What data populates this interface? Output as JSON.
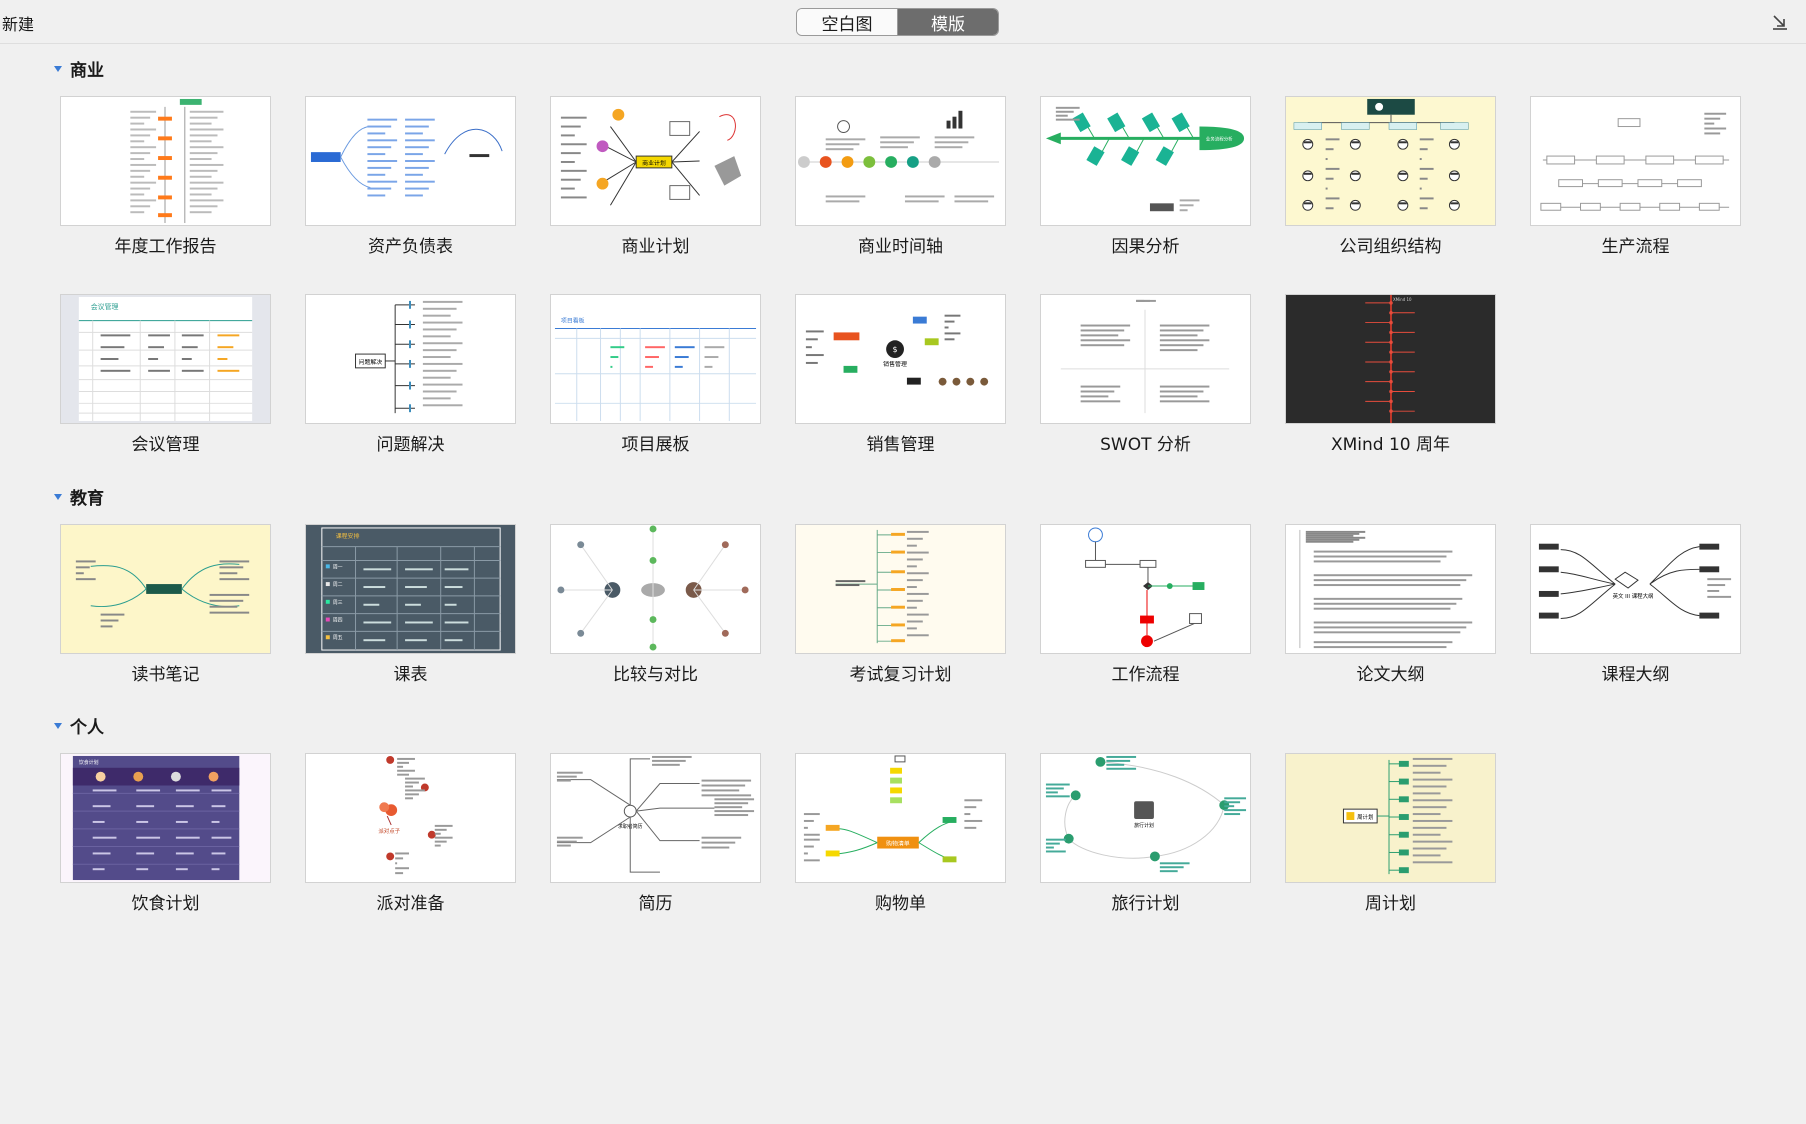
{
  "header": {
    "title": "新建",
    "tab_blank": "空白图",
    "tab_template": "模版",
    "import_icon": "import-arrow-icon"
  },
  "sections": [
    {
      "title": "商业",
      "items": [
        {
          "label": "年度工作报告",
          "thumb": "annual"
        },
        {
          "label": "资产负债表",
          "thumb": "balance"
        },
        {
          "label": "商业计划",
          "thumb": "bizplan"
        },
        {
          "label": "商业时间轴",
          "thumb": "timeline"
        },
        {
          "label": "因果分析",
          "thumb": "fishbone"
        },
        {
          "label": "公司组织结构",
          "thumb": "orgchart"
        },
        {
          "label": "生产流程",
          "thumb": "production"
        },
        {
          "label": "会议管理",
          "thumb": "meeting"
        },
        {
          "label": "问题解决",
          "thumb": "problem"
        },
        {
          "label": "项目展板",
          "thumb": "project"
        },
        {
          "label": "销售管理",
          "thumb": "sales"
        },
        {
          "label": "SWOT 分析",
          "thumb": "swot"
        },
        {
          "label": "XMind 10 周年",
          "thumb": "xmind"
        }
      ]
    },
    {
      "title": "教育",
      "items": [
        {
          "label": "读书笔记",
          "thumb": "reading"
        },
        {
          "label": "课表",
          "thumb": "schedule"
        },
        {
          "label": "比较与对比",
          "thumb": "compare"
        },
        {
          "label": "考试复习计划",
          "thumb": "exam"
        },
        {
          "label": "工作流程",
          "thumb": "workflow"
        },
        {
          "label": "论文大纲",
          "thumb": "thesis"
        },
        {
          "label": "课程大纲",
          "thumb": "course"
        }
      ]
    },
    {
      "title": "个人",
      "items": [
        {
          "label": "饮食计划",
          "thumb": "diet"
        },
        {
          "label": "派对准备",
          "thumb": "party"
        },
        {
          "label": "简历",
          "thumb": "resume"
        },
        {
          "label": "购物单",
          "thumb": "shopping"
        },
        {
          "label": "旅行计划",
          "thumb": "travel"
        },
        {
          "label": "周计划",
          "thumb": "weekly"
        }
      ]
    }
  ],
  "thumb_text": {
    "meeting_title": "会议管理",
    "problem_center": "问题解决",
    "project_title": "项目看板",
    "sales_center": "销售管理",
    "xmind_title": "XMind 10",
    "schedule_title": "课程安排",
    "schedule_rows": [
      "周一",
      "周二",
      "周三",
      "周四",
      "周五"
    ],
    "course_center": "英文 III 课程大纲",
    "diet_title": "饮食计划",
    "party_center": "派对点子",
    "travel_center": "旅行计划",
    "weekly_center": "周计划",
    "shopping_center": "购物清单",
    "resume_center": "求职者简历",
    "bizplan_center": "商业计划",
    "fishbone_head": "业务流程分析"
  }
}
